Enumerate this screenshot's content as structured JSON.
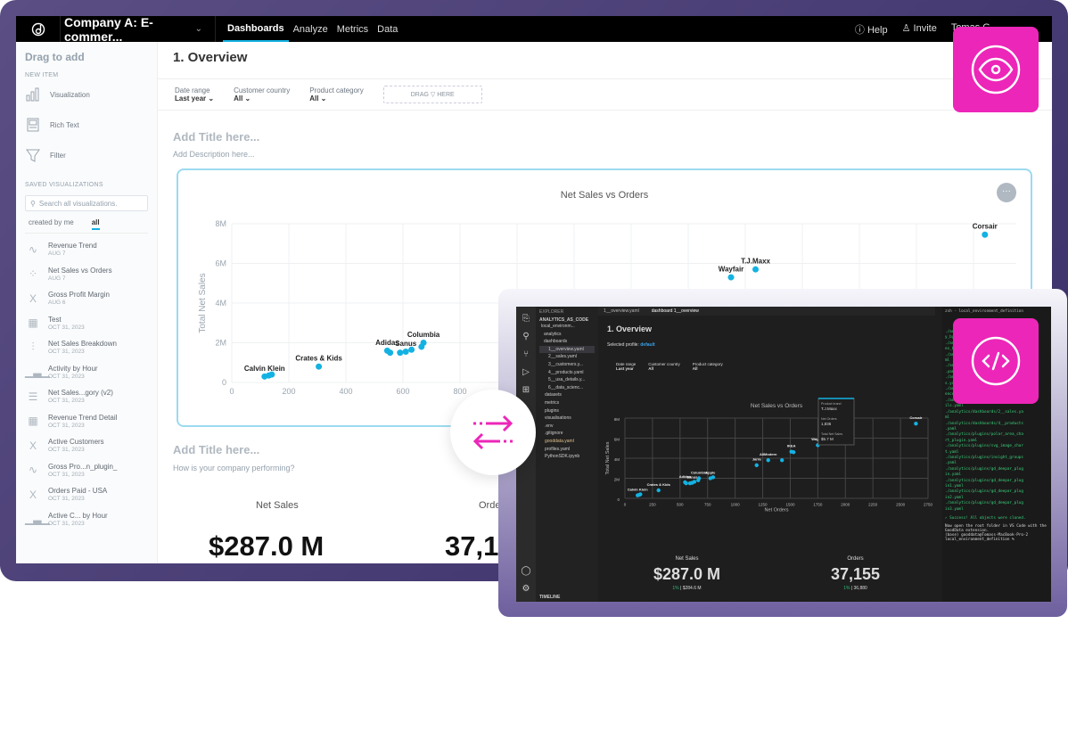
{
  "topbar": {
    "workspace": "Company A: E-commer...",
    "nav": [
      "Dashboards",
      "Analyze",
      "Metrics",
      "Data"
    ],
    "active_nav": "Dashboards",
    "help": "Help",
    "invite": "Invite",
    "user": "Tomas G..."
  },
  "sidebar": {
    "title": "Drag to add",
    "new_item_label": "NEW ITEM",
    "new_items": [
      "Visualization",
      "Rich Text",
      "Filter"
    ],
    "saved_label": "SAVED VISUALIZATIONS",
    "search_placeholder": "Search all visualizations.",
    "tabs": [
      "created by me",
      "all"
    ],
    "active_tab": "all",
    "items": [
      {
        "name": "Revenue Trend",
        "date": "AUG 7",
        "icon": "line-chart-icon"
      },
      {
        "name": "Net Sales vs Orders",
        "date": "AUG 7",
        "icon": "scatter-icon"
      },
      {
        "name": "Gross Profit Margin",
        "date": "AUG 6",
        "icon": "headline-icon"
      },
      {
        "name": "Test",
        "date": "OCT 31, 2023",
        "icon": "table-icon"
      },
      {
        "name": "Net Sales Breakdown",
        "date": "OCT 31, 2023",
        "icon": "waterfall-icon"
      },
      {
        "name": "Activity by Hour",
        "date": "OCT 31, 2023",
        "icon": "bar-chart-icon"
      },
      {
        "name": "Net Sales...gory (v2)",
        "date": "OCT 31, 2023",
        "icon": "bar-horizontal-icon"
      },
      {
        "name": "Revenue Trend Detail",
        "date": "OCT 31, 2023",
        "icon": "table-icon"
      },
      {
        "name": "Active Customers",
        "date": "OCT 31, 2023",
        "icon": "headline-icon"
      },
      {
        "name": "Gross Pro...n_plugin_",
        "date": "OCT 31, 2023",
        "icon": "line-chart-icon"
      },
      {
        "name": "Orders Paid - USA",
        "date": "OCT 31, 2023",
        "icon": "headline-icon"
      },
      {
        "name": "Active C... by Hour",
        "date": "OCT 31, 2023",
        "icon": "bar-chart-icon"
      }
    ]
  },
  "dashboard": {
    "title": "1. Overview",
    "filters": [
      {
        "label": "Date range",
        "value": "Last year"
      },
      {
        "label": "Customer country",
        "value": "All"
      },
      {
        "label": "Product category",
        "value": "All"
      }
    ],
    "drag_here": "DRAG ▽ HERE",
    "section1_title": "Add Title here...",
    "section1_desc": "Add Description here...",
    "section2_title": "Add Title here...",
    "section2_desc": "How is your company performing?",
    "kpis": [
      {
        "label": "Net Sales",
        "value": "$287.0 M"
      },
      {
        "label": "Orders",
        "value": "37,1"
      }
    ]
  },
  "chart_data": {
    "type": "scatter",
    "title": "Net Sales vs Orders",
    "xlabel": "Net Orders",
    "ylabel": "Total Net Sales",
    "xlim": [
      0,
      2750
    ],
    "ylim": [
      0,
      8000000
    ],
    "yticks": [
      "0",
      "2M",
      "4M",
      "6M",
      "8M"
    ],
    "xticks_light": [
      "0",
      "200",
      "400",
      "600",
      "800"
    ],
    "xticks_dark": [
      "0",
      "250",
      "500",
      "750",
      "1000",
      "1250",
      "1500",
      "1750",
      "2000",
      "2250",
      "2500",
      "2750"
    ],
    "points": [
      {
        "x": 115,
        "y": 300000,
        "label": "Calvin Klein"
      },
      {
        "x": 130,
        "y": 350000,
        "label": ""
      },
      {
        "x": 140,
        "y": 400000,
        "label": ""
      },
      {
        "x": 305,
        "y": 800000,
        "label": "Crates & Kids"
      },
      {
        "x": 545,
        "y": 1600000,
        "label": "Adidas"
      },
      {
        "x": 555,
        "y": 1500000,
        "label": ""
      },
      {
        "x": 590,
        "y": 1500000,
        "label": ""
      },
      {
        "x": 610,
        "y": 1550000,
        "label": "Sanus"
      },
      {
        "x": 630,
        "y": 1650000,
        "label": ""
      },
      {
        "x": 665,
        "y": 1800000,
        "label": ""
      },
      {
        "x": 672,
        "y": 2000000,
        "label": "Columbia"
      },
      {
        "x": 775,
        "y": 2000000,
        "label": "Apple"
      },
      {
        "x": 800,
        "y": 2100000,
        "label": ""
      },
      {
        "x": 1195,
        "y": 3300000,
        "label": "Jarra"
      },
      {
        "x": 1300,
        "y": 3800000,
        "label": "AllModern"
      },
      {
        "x": 1425,
        "y": 3800000,
        "label": ""
      },
      {
        "x": 1510,
        "y": 4650000,
        "label": "IKEA"
      },
      {
        "x": 1530,
        "y": 4600000,
        "label": ""
      },
      {
        "x": 1750,
        "y": 5300000,
        "label": "Wayfair"
      },
      {
        "x": 1836,
        "y": 5700000,
        "label": "T.J.Maxx"
      },
      {
        "x": 2640,
        "y": 7450000,
        "label": "Corsair"
      }
    ],
    "tooltip": {
      "Product brand": "T.J.Maxx",
      "Net Orders": "1,836",
      "Total Net Sales": "$5.7 M"
    }
  },
  "ide": {
    "explorer": "EXPLORER",
    "root": "ANALYTICS_AS_CODE",
    "tree": [
      "local_environm...",
      "analytics",
      "dashboards",
      "1__overview.yaml",
      "2__sales.yaml",
      "3__customers.y...",
      "4__products.yaml",
      "5__usa_details.y...",
      "6__data_scienc...",
      "datasets",
      "metrics",
      "plugins",
      "visualisations",
      ".env",
      ".gitignore",
      "gooddata.yaml",
      "profiles.yaml",
      "PythonSDK.ipynb"
    ],
    "timeline": "TIMELINE",
    "tabs": [
      "1__overview.yaml",
      "dashboard 1__overview"
    ],
    "title": "1. Overview",
    "profile_label": "Selected profile:",
    "profile": "default",
    "kpis": [
      {
        "label": "Net Sales",
        "value": "$287.0 M",
        "change": "1%",
        "prev": "$284.6 M"
      },
      {
        "label": "Orders",
        "value": "37,155",
        "change": "1%",
        "prev": "36,880"
      }
    ],
    "terminal_title": "zsh - local_environment_definition",
    "terminal": [
      "./analytics/visualisations/activit",
      "y_by_hour.yaml",
      "./analytics/visualisations/net_sal",
      "es_breakdown1.yaml",
      "./analytics/visualisations/test.ya",
      "ml",
      "./analytics/dashboards/1__overview",
      ".yaml",
      "./analytics/dashboards/3__customer",
      "s.yaml",
      "./analytics/dashboards/6__data_sci",
      "ence__ml.yaml",
      "./analytics/dashboards/5__usa_deta",
      "ils.yaml",
      "./analytics/dashboards/2__sales.ya",
      "ml",
      "./analytics/dashboards/4__products",
      ".yaml",
      "./analytics/plugins/polar_area_cha",
      "rt_plugin.yaml",
      "./analytics/plugins/svg_image_char",
      "t.yaml",
      "./analytics/plugins/insight_groups",
      ".yaml",
      "./analytics/plugins/gd_deepar_plug",
      "in.yaml",
      "./analytics/plugins/gd_deepar_plug",
      "in1.yaml",
      "./analytics/plugins/gd_deepar_plug",
      "in2.yaml",
      "./analytics/plugins/gd_deepar_plug",
      "in3.yaml"
    ],
    "success": "✓ Success! All objects were cloned.",
    "msg": "Now open the root folder in VS Code with the GoodData extension.",
    "prompt": "(base) gooddata@Tomass-MacBook-Pro-2 local_environment_definition % "
  },
  "colors": {
    "accent": "#14b2e2",
    "badge": "#ec26b8",
    "frame": "#4a3f78"
  }
}
